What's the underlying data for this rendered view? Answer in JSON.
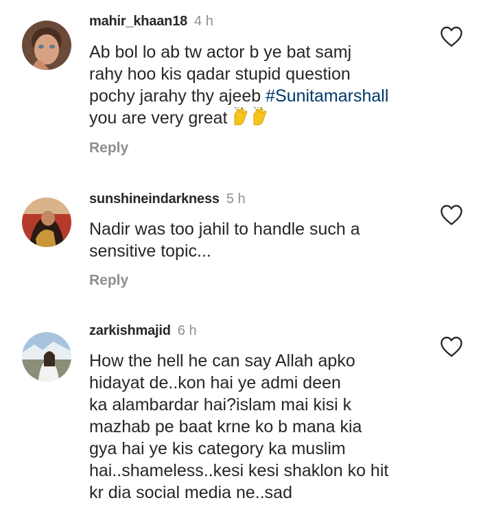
{
  "comments": [
    {
      "username": "mahir_khaan18",
      "time": "4 h",
      "text_before": "Ab bol lo ab tw actor b ye bat samj\nrahy hoo kis qadar stupid question\npochy jarahy thy ajeeb ",
      "hashtag": "#Sunitamarshall",
      "text_after": "\nyou are very great ",
      "emoji": "raising-hands-emoji x2",
      "reply_label": "Reply"
    },
    {
      "username": "sunshineindarkness",
      "time": "5 h",
      "text": "Nadir was too jahil to handle such a\nsensitive topic...",
      "reply_label": "Reply"
    },
    {
      "username": "zarkishmajid",
      "time": "6 h",
      "text": "How the hell he can say Allah apko\nhidayat de..kon hai ye admi deen\nka alambardar hai?islam mai kisi k\nmazhab pe baat krne ko b mana kia\ngya hai ye kis category ka muslim\nhai..shameless..kesi kesi shaklon ko hit\nkr dia social media ne..sad"
    }
  ],
  "colors": {
    "username": "#262626",
    "muted": "#8e8e8e",
    "hashtag": "#00376b"
  },
  "icons": {
    "like": "heart-outline-icon"
  }
}
